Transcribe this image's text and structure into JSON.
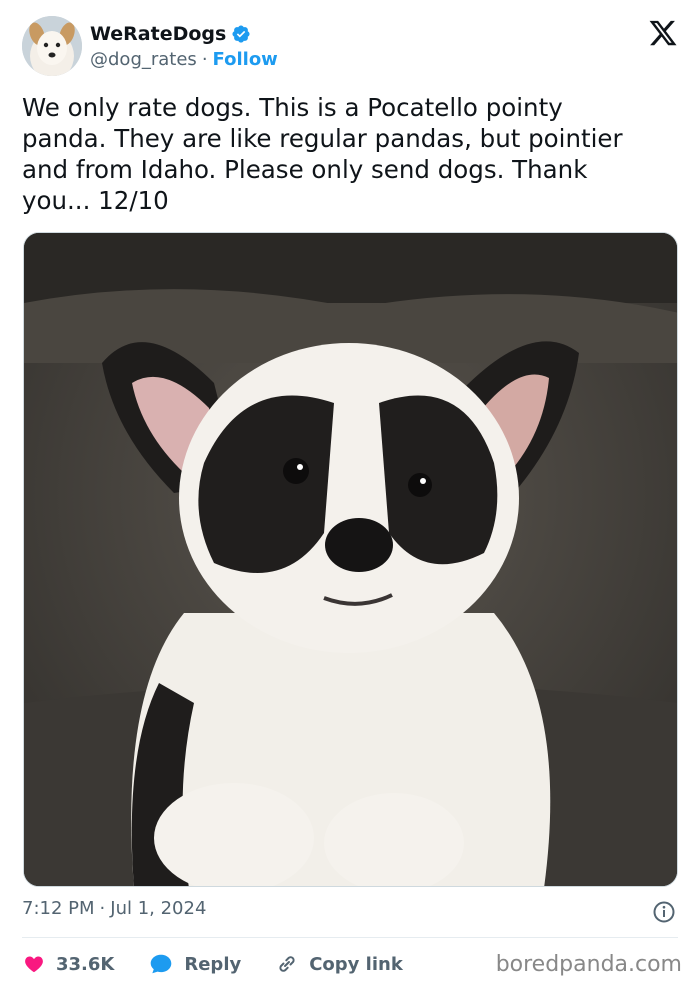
{
  "author": {
    "display_name": "WeRateDogs",
    "handle": "@dog_rates",
    "separator": "·",
    "follow_label": "Follow"
  },
  "tweet": {
    "text": "We only rate dogs. This is a Pocatello pointy\npanda. They are like regular pandas, but pointier\nand from Idaho. Please only send dogs. Thank\nyou... 12/10",
    "time": "7:12 PM",
    "separator": "·",
    "date": "Jul 1, 2024"
  },
  "actions": {
    "likes": "33.6K",
    "reply_label": "Reply",
    "copy_link_label": "Copy link"
  },
  "watermark": "boredpanda.com",
  "icons": {
    "verified": "verified-badge-icon",
    "logo": "x-logo-icon",
    "info": "info-icon",
    "like": "heart-icon",
    "reply": "speech-bubble-icon",
    "copy": "link-icon"
  },
  "colors": {
    "accent": "#1d9bf0",
    "like": "#f91880",
    "text": "#0f1419",
    "muted": "#536471"
  }
}
